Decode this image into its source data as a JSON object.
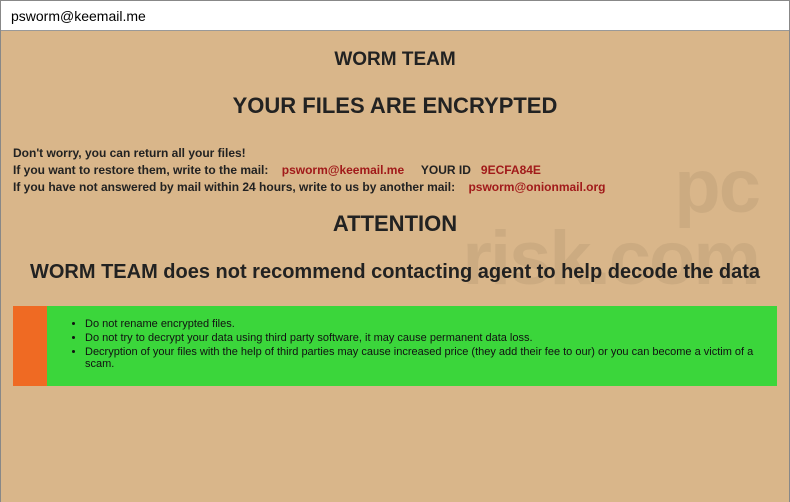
{
  "window": {
    "title": "psworm@keemail.me"
  },
  "headings": {
    "team": "WORM TEAM",
    "encrypted": "YOUR FILES ARE ENCRYPTED",
    "attention": "ATTENTION",
    "advice": "WORM TEAM does not recommend contacting agent to help decode the data"
  },
  "intro": {
    "line1": "Don't worry, you can return all your files!",
    "line2a": "If you want to restore them, write to the mail:",
    "email1": "psworm@keemail.me",
    "your_id_label": "YOUR ID",
    "your_id_value": "9ECFA84E",
    "line3a": "If you have not answered by mail within 24 hours, write to us by another mail:",
    "email2": "psworm@onionmail.org"
  },
  "warnings": {
    "item1": "Do not rename encrypted files.",
    "item2": "Do not try to decrypt your data using third party software, it may cause permanent data loss.",
    "item3": "Decryption of your files with the help of third parties may cause increased price (they add their fee to our) or you can become a victim of a scam."
  },
  "watermark": {
    "line1": "pc",
    "line2": "risk.com"
  }
}
